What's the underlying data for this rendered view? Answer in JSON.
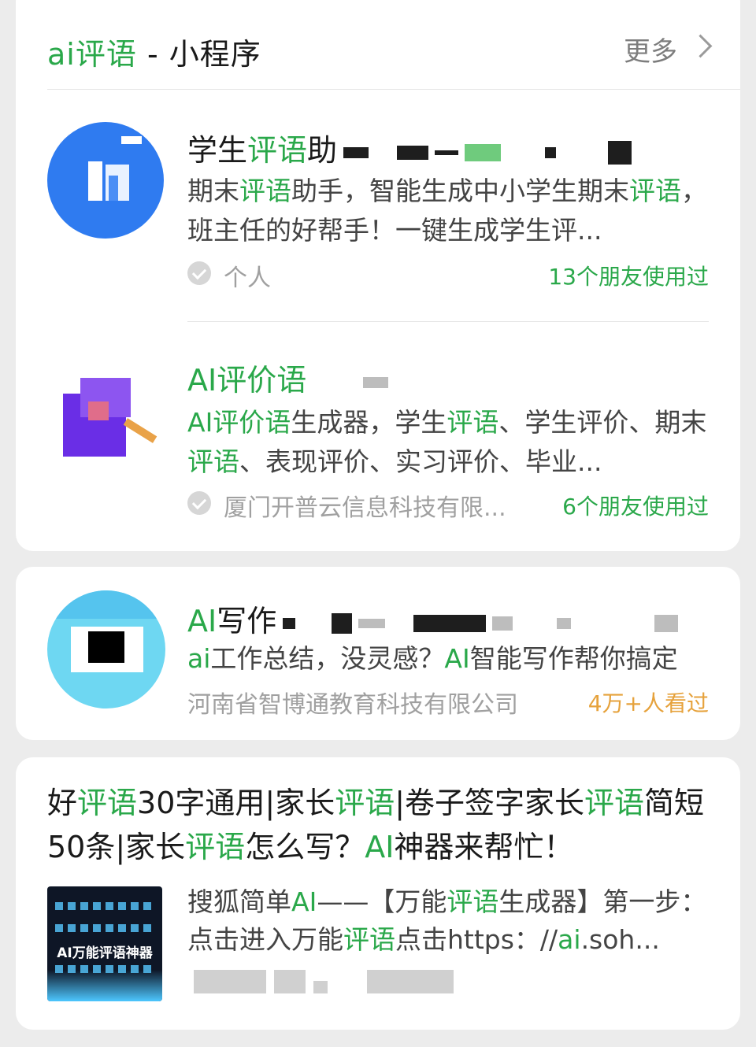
{
  "section": {
    "title_highlight": "ai评语",
    "title_rest": " - 小程序",
    "more_label": "更多"
  },
  "apps": [
    {
      "name_a": "学生",
      "name_b": "评语",
      "name_c": "助",
      "desc_parts": [
        "期末",
        "评语",
        "助手，智能生成中小学生期末",
        "评",
        "语",
        "，班主任的好帮手！一键生成学生评..."
      ],
      "owner": "个人",
      "usage": "13个朋友使用过"
    },
    {
      "name_a": "AI评价语",
      "desc_parts": [
        "AI评价语",
        "生成器，学生",
        "评语",
        "、学生评价、期末",
        "评语",
        "、表现评价、实习评价、毕业..."
      ],
      "owner": "厦门开普云信息科技有限...",
      "usage": "6个朋友使用过"
    }
  ],
  "ad": {
    "name_a": "AI",
    "name_b": "写作",
    "desc_a": "ai",
    "desc_b": "工作总结，没灵感？",
    "desc_c": "AI",
    "desc_d": "智能写作帮你搞定",
    "owner": "河南省智博通教育科技有限公司",
    "views": "4万+人看过"
  },
  "article": {
    "title_parts": [
      "好",
      "评语",
      "30字通用|家长",
      "评语",
      "|卷子签字家长",
      "评语",
      "简短50条|家长",
      "评语",
      "怎么写？",
      "AI",
      "神器来帮忙！"
    ],
    "snippet_parts": [
      "搜狐简单",
      "AI",
      "——【万能",
      "评语",
      "生成器】第一步：点击进入万能",
      "评语",
      "点击https：//",
      "ai",
      ".soh..."
    ],
    "thumb_label": "AI万能评语神器"
  },
  "colors": {
    "highlight": "#2aa84a",
    "views": "#e6a23c",
    "background": "#ececec"
  },
  "icons": [
    "chevron-right-icon",
    "verified-icon"
  ]
}
